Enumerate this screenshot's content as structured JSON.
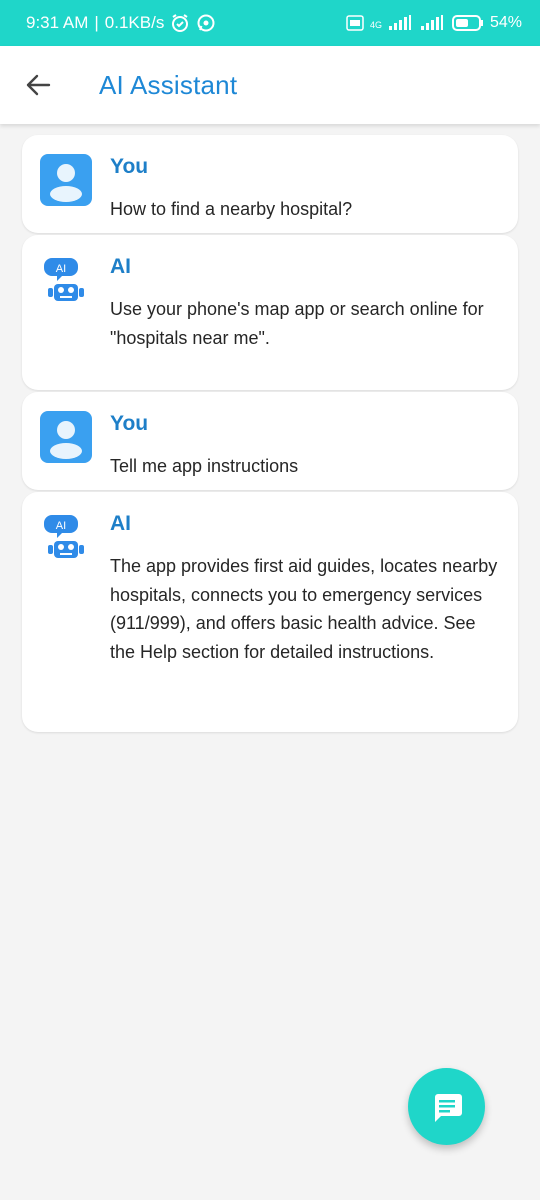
{
  "status_bar": {
    "time": "9:31 AM",
    "speed": "0.1KB/s",
    "network": "4G",
    "battery": "54%"
  },
  "app_bar": {
    "title": "AI Assistant"
  },
  "messages": [
    {
      "sender": "You",
      "text": "How to find a nearby hospital?"
    },
    {
      "sender": "AI",
      "text": "Use your phone's map app or search online for \"hospitals near me\"."
    },
    {
      "sender": "You",
      "text": "Tell me app instructions"
    },
    {
      "sender": "AI",
      "text": "The app provides first aid guides, locates nearby hospitals, connects you to emergency services (911/999), and offers basic health advice.  See the Help section for detailed instructions."
    }
  ],
  "ai_avatar_badge": "AI",
  "colors": {
    "accent": "#1fd6c9",
    "title": "#1e88d6",
    "sender": "#1e7fc8",
    "background": "#f4f4f4"
  }
}
